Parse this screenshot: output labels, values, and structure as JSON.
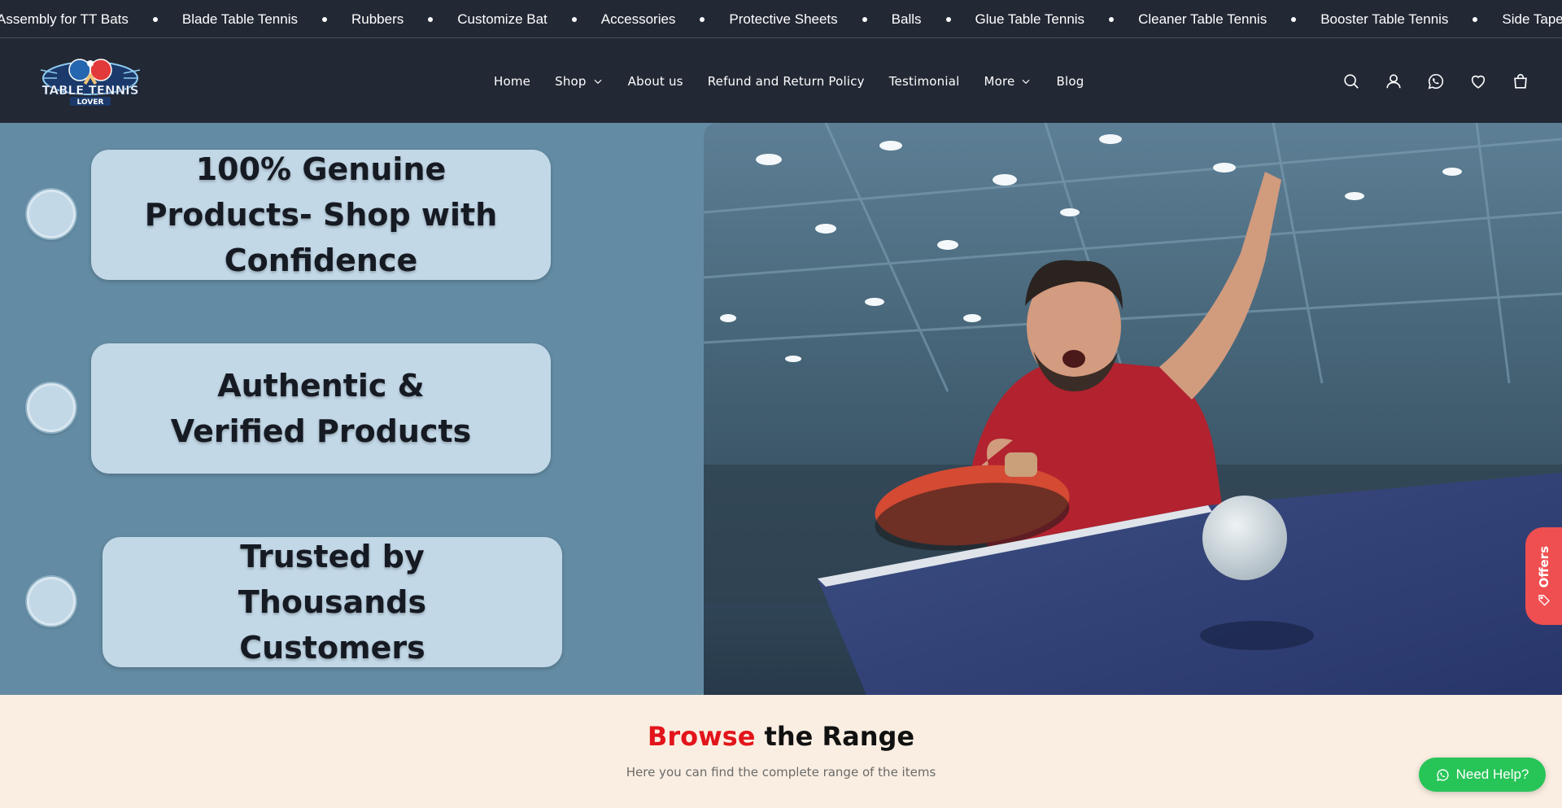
{
  "marquee": {
    "items": [
      "Assembly for TT Bats",
      "Blade Table Tennis",
      "Rubbers",
      "Customize Bat",
      "Accessories",
      "Protective Sheets",
      "Balls",
      "Glue Table Tennis",
      "Cleaner Table Tennis",
      "Booster Table Tennis",
      "Side Tape"
    ]
  },
  "header": {
    "logo_text": "TABLE TENNIS LOVER",
    "nav": [
      {
        "label": "Home",
        "dropdown": false
      },
      {
        "label": "Shop",
        "dropdown": true
      },
      {
        "label": "About us",
        "dropdown": false
      },
      {
        "label": "Refund and Return Policy",
        "dropdown": false
      },
      {
        "label": "Testimonial",
        "dropdown": false
      },
      {
        "label": "More",
        "dropdown": true
      },
      {
        "label": "Blog",
        "dropdown": false
      }
    ],
    "icons": [
      "search-icon",
      "user-icon",
      "whatsapp-icon",
      "heart-icon",
      "cart-icon"
    ]
  },
  "hero": {
    "features": [
      "100% Genuine Products- Shop with Confidence",
      "Authentic & Verified Products",
      "Trusted by Thousands Customers"
    ],
    "offers_label": "Offers"
  },
  "browse": {
    "title_accent": "Browse",
    "title_rest": "the Range",
    "subtitle": "Here you can find the complete range of the items"
  },
  "help_button": {
    "label": "Need Help?"
  },
  "colors": {
    "header_bg": "#222834",
    "hero_bg": "#638ca4",
    "card_bg": "#c2d8e7",
    "browse_bg": "#faeee2",
    "accent_red": "#e3141b",
    "offers_red": "#ef4f50",
    "help_green": "#27c558"
  }
}
